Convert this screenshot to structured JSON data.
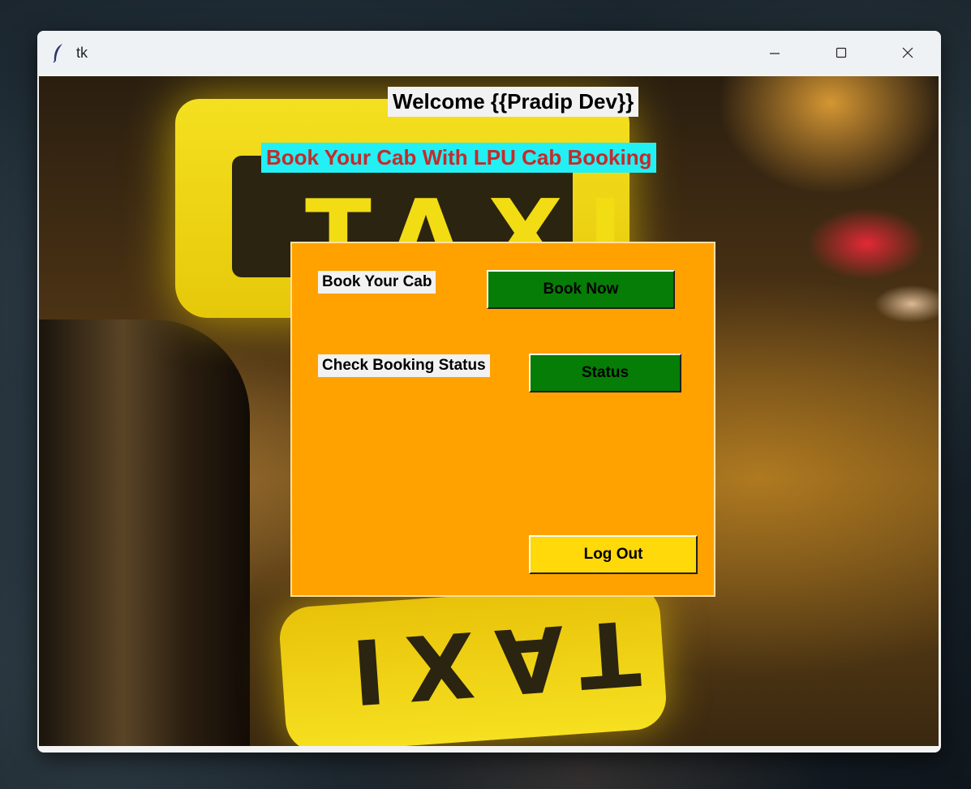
{
  "window": {
    "title": "tk",
    "controls": [
      "minimize-icon",
      "maximize-icon",
      "close-icon"
    ]
  },
  "welcome": "Welcome {{Pradip Dev}}",
  "heading": "Book Your Cab With LPU Cab Booking",
  "panel": {
    "book_label": "Book Your Cab",
    "book_button": "Book Now",
    "status_label": "Check Booking Status",
    "status_button": "Status",
    "logout_button": "Log Out"
  },
  "background": {
    "sign_top_text": "TAXI",
    "sign_bottom_text": "TAXI"
  },
  "colors": {
    "panel": "#ffa200",
    "heading_bg": "#22f0f4",
    "heading_text": "#c62a2a",
    "action_button": "#067d06",
    "logout_button": "#ffd90a"
  }
}
